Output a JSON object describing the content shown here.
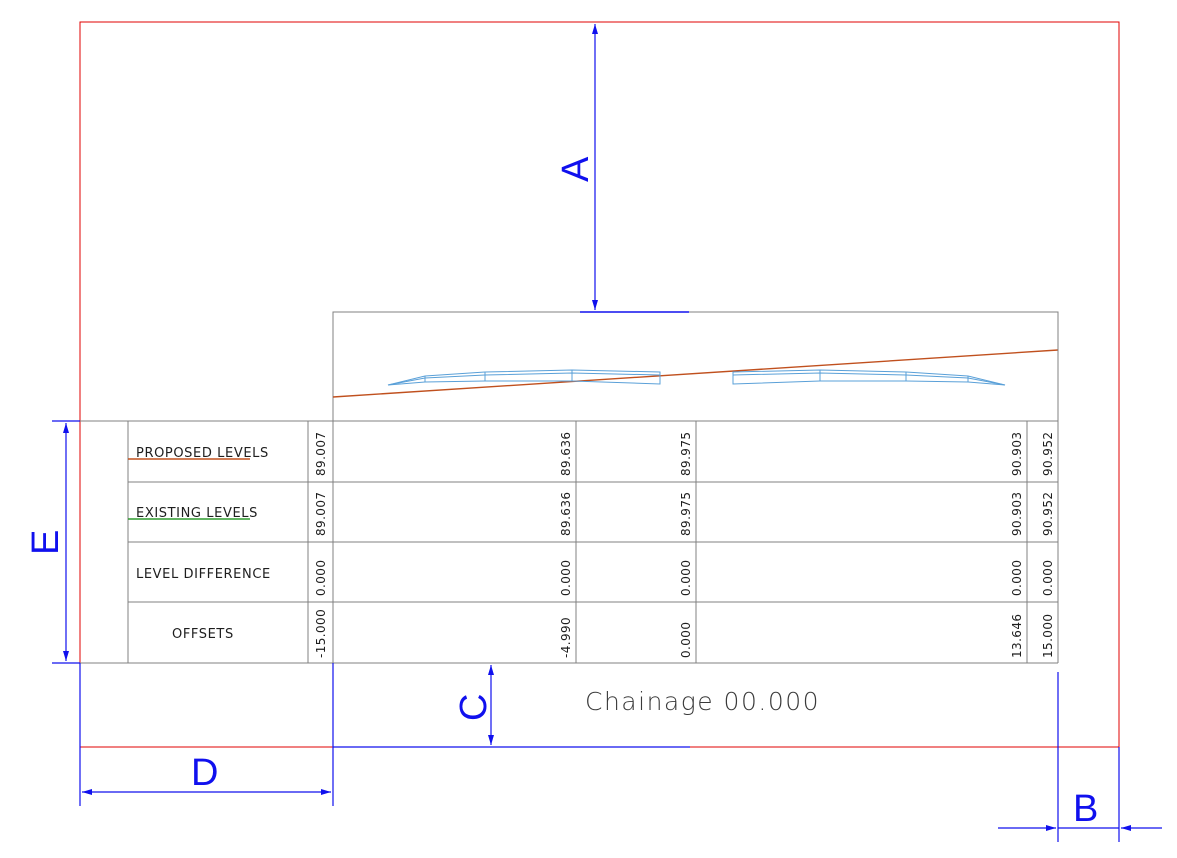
{
  "table": {
    "row_labels": [
      "PROPOSED LEVELS",
      "EXISTING LEVELS",
      "LEVEL DIFFERENCE",
      "OFFSETS"
    ],
    "columns": [
      {
        "proposed": "89.007",
        "existing": "89.007",
        "difference": "0.000",
        "offset": "-15.000"
      },
      {
        "proposed": "89.636",
        "existing": "89.636",
        "difference": "0.000",
        "offset": "-4.990"
      },
      {
        "proposed": "89.975",
        "existing": "89.975",
        "difference": "0.000",
        "offset": "0.000"
      },
      {
        "proposed": "90.903",
        "existing": "90.903",
        "difference": "0.000",
        "offset": "13.646"
      },
      {
        "proposed": "90.952",
        "existing": "90.952",
        "difference": "0.000",
        "offset": "15.000"
      }
    ]
  },
  "chainage_label": "Chainage 00.000",
  "dimension_labels": {
    "a": "A",
    "b": "B",
    "c": "C",
    "d": "D",
    "e": "E"
  },
  "colors": {
    "sheet_border": "#e00000",
    "dimension": "#1010ee",
    "grid": "#808080",
    "proposed_line": "#c0501e",
    "existing_line": "#2e9a2e",
    "road_section": "#5aa0d8"
  }
}
